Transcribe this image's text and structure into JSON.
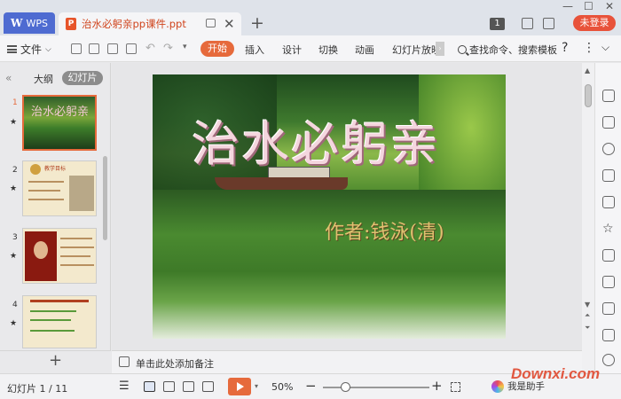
{
  "titlebar": {
    "app_tab_label": "WPS",
    "doc_tab_title": "治水必躬亲pp课件.ppt",
    "page_badge": "1",
    "login_label": "未登录"
  },
  "toolbar": {
    "file_menu_label": "文件",
    "tabs": [
      "开始",
      "插入",
      "设计",
      "切换",
      "动画",
      "幻灯片放映"
    ],
    "search_label": "查找命令、搜索模板",
    "help_label": "?"
  },
  "left_panel": {
    "outline_tab": "大纲",
    "slides_tab": "幻灯片",
    "thumb_numbers": [
      "1",
      "2",
      "3",
      "4"
    ],
    "thumb1_title": "治水必躬亲",
    "thumb2_heading": "教学目标",
    "add_slide_label": "+"
  },
  "slide": {
    "title": "治水必躬亲",
    "author": "作者:钱泳(清)"
  },
  "notes": {
    "placeholder": "单击此处添加备注"
  },
  "statusbar": {
    "slide_counter": "幻灯片 1 / 11",
    "zoom": "50%",
    "zoom_level": 0.5,
    "assistant_label": "我是助手"
  },
  "watermark": "Downxi.com",
  "colors": {
    "accent": "#e66a3c",
    "wps_blue": "#4e6bd1",
    "login_red": "#e8523a"
  }
}
